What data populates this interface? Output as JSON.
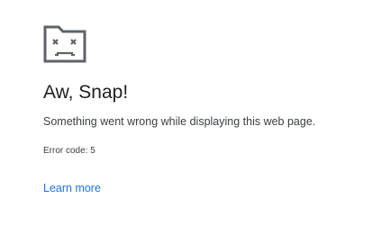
{
  "error_page": {
    "icon": "sad-tab-icon",
    "title": "Aw, Snap!",
    "message": "Something went wrong while displaying this web page.",
    "error_code_text": "Error code: 5",
    "learn_more_label": "Learn more"
  },
  "colors": {
    "title": "#202124",
    "body_text": "#3c4043",
    "link": "#1a73e8",
    "icon_stroke": "#5f6368",
    "background": "#ffffff"
  }
}
